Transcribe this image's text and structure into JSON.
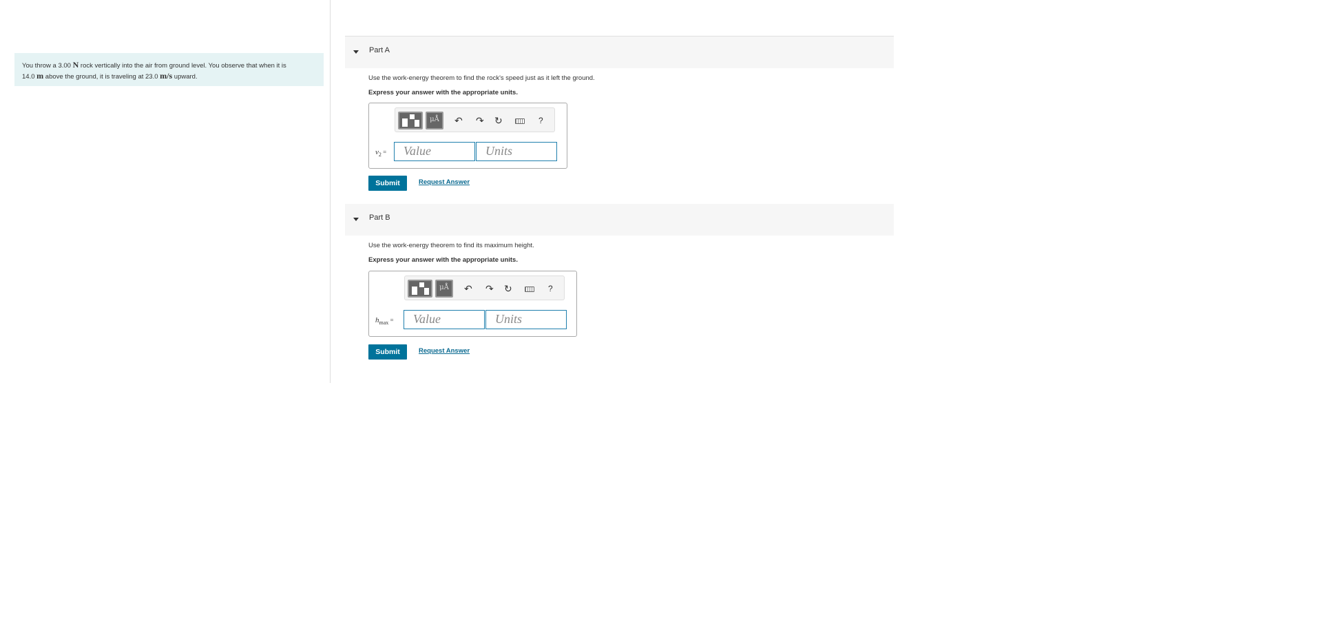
{
  "problem": {
    "text_1": "You throw a 3.00 ",
    "sym_1": "N",
    "text_2": " rock vertically into the air from ground level. You observe that when it is",
    "text_3": "14.0 ",
    "sym_2": "m",
    "text_4": " above the ground, it is traveling at 23.0 ",
    "sym_3": "m/s",
    "text_5": " upward."
  },
  "parts": [
    {
      "title": "Part A",
      "prompt": "Use the work-energy theorem to find the rock's speed just as it left the ground.",
      "instruction": "Express your answer with the appropriate units.",
      "var_main": "v",
      "var_sub": "2",
      "var_eq": " =",
      "value_placeholder": "Value",
      "units_placeholder": "Units",
      "units_button": "μÅ",
      "help": "?",
      "submit": "Submit",
      "request": "Request Answer"
    },
    {
      "title": "Part B",
      "prompt": "Use the work-energy theorem to find its maximum height.",
      "instruction": "Express your answer with the appropriate units.",
      "var_main": "h",
      "var_sub": "max",
      "var_eq": " =",
      "value_placeholder": "Value",
      "units_placeholder": "Units",
      "units_button": "μÅ",
      "help": "?",
      "submit": "Submit",
      "request": "Request Answer"
    }
  ]
}
